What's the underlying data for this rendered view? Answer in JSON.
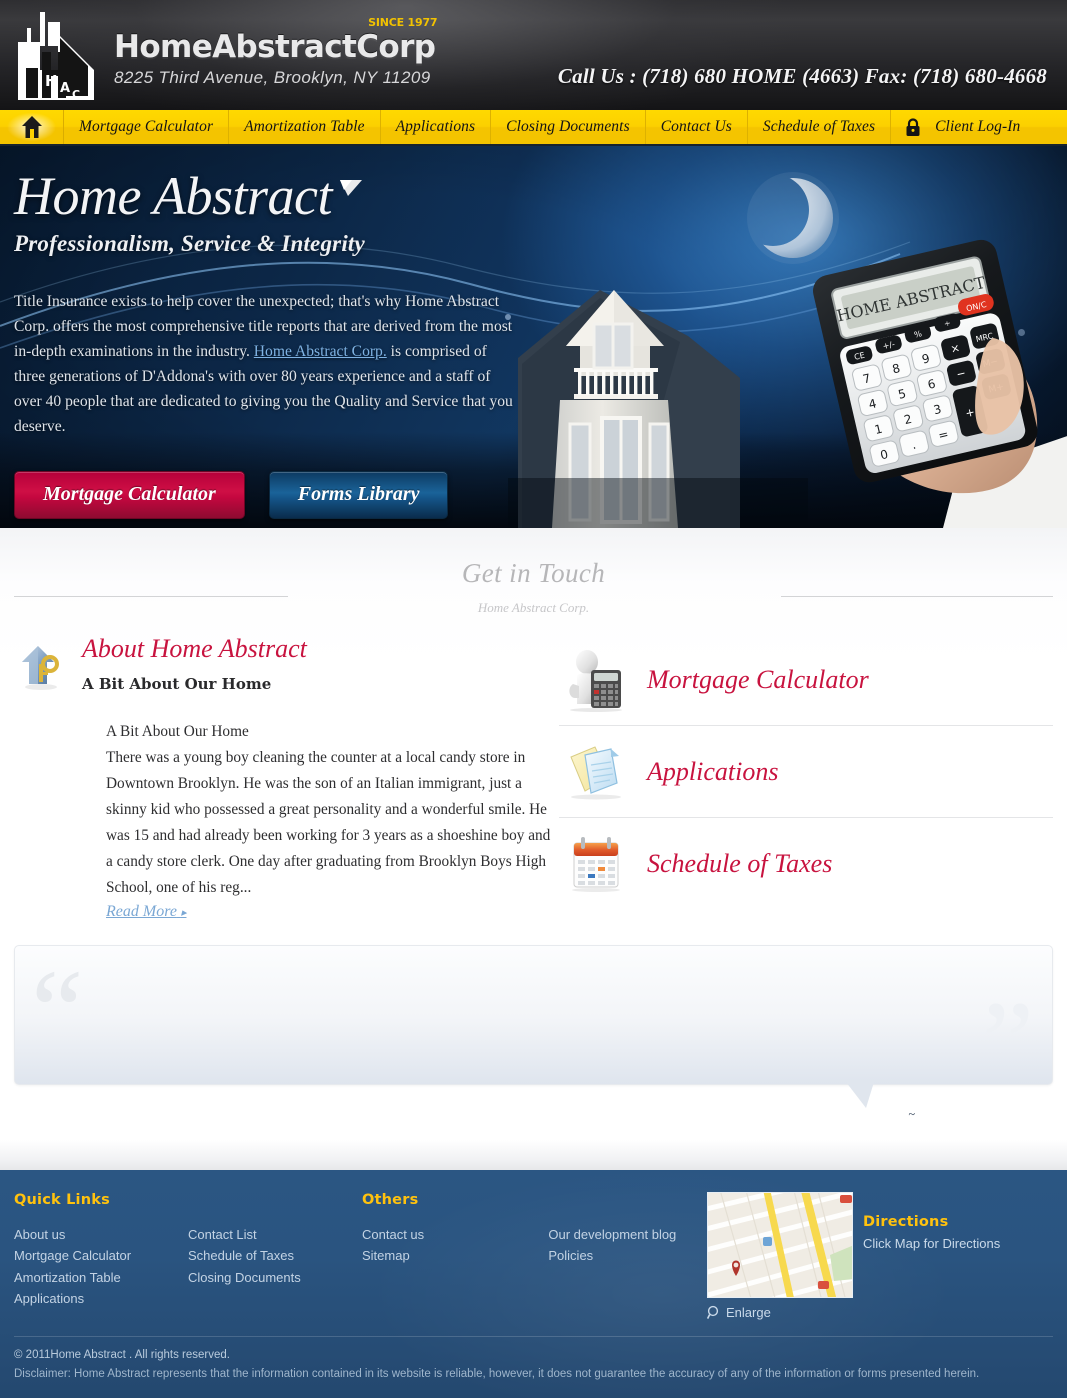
{
  "header": {
    "logo_name": "HomeAbstractCorp",
    "logo_since": "SINCE 1977",
    "address": "8225 Third Avenue, Brooklyn, NY 11209",
    "phone": "Call Us : (718) 680 HOME (4663) Fax: (718) 680-4668"
  },
  "nav": {
    "home_icon": "home-icon",
    "lock_icon": "lock-icon",
    "items": [
      {
        "label": "Mortgage Calculator"
      },
      {
        "label": "Amortization Table"
      },
      {
        "label": "Applications"
      },
      {
        "label": "Closing Documents"
      },
      {
        "label": "Contact Us"
      },
      {
        "label": "Schedule of Taxes"
      },
      {
        "label": "Client Log-In"
      }
    ]
  },
  "hero": {
    "title": "Home Abstract",
    "tagline": "Professionalism, Service & Integrity",
    "paragraph_part1": "Title Insurance exists to help cover the unexpected; that's why Home Abstract Corp. offers the most comprehensive title reports that are derived from the most in-depth examinations in the industry. ",
    "paragraph_link": "Home Abstract Corp.",
    "paragraph_part2": " is comprised of three generations of D'Addona's with over 80 years experience and a staff of over 40 people that are dedicated to giving you the Quality and Service that you deserve.",
    "button_primary": "Mortgage Calculator",
    "button_secondary": "Forms Library",
    "calculator_display": "HOME ABSTRACT"
  },
  "section": {
    "title": "Get in Touch",
    "subtitle": "Home Abstract Corp."
  },
  "about": {
    "title": "About Home Abstract",
    "subtitle": "A Bit About Our Home",
    "body": "A Bit About Our Home\nThere was a young boy cleaning the counter at a local candy store in Downtown Brooklyn. He was the son of an Italian immigrant, just a skinny kid who possessed a great personality and a wonderful smile. He was 15 and had already been working for 3 years as a shoeshine boy and a candy store clerk. One day after graduating from Brooklyn Boys High School, one of his reg...",
    "read_more": "Read More",
    "read_more_caret": "▸"
  },
  "quick_links_panel": [
    {
      "label": "Mortgage Calculator",
      "icon": "calculator-icon"
    },
    {
      "label": "Applications",
      "icon": "documents-icon"
    },
    {
      "label": "Schedule of Taxes",
      "icon": "calendar-icon"
    }
  ],
  "quote": {
    "open_mark": "“",
    "close_mark": "”",
    "text": "",
    "author": "~"
  },
  "footer": {
    "quick_links_title": "Quick Links",
    "quick_links_col1": [
      "About us",
      "Mortgage Calculator",
      "Amortization Table",
      "Applications"
    ],
    "quick_links_col2": [
      "Contact List",
      "Schedule of Taxes",
      "Closing Documents"
    ],
    "others_title": "Others",
    "others_col1": [
      "Contact us",
      "Sitemap"
    ],
    "others_col2": [
      "Our development blog",
      "Policies"
    ],
    "directions_title": "Directions",
    "directions_caption": "Click Map for Directions",
    "enlarge_label": "Enlarge",
    "copyright": "© 2011Home Abstract . All rights reserved.",
    "disclaimer": "Disclaimer: Home Abstract represents that the information contained in its website is reliable, however, it does not guarantee the accuracy of any of the information or forms presented herein."
  },
  "colors": {
    "nav_yellow": "#fcd000",
    "accent_red": "#c8133f",
    "footer_blue": "#2a5480",
    "footer_gold": "#ffc20e",
    "link_blue": "#7aa7d4"
  }
}
